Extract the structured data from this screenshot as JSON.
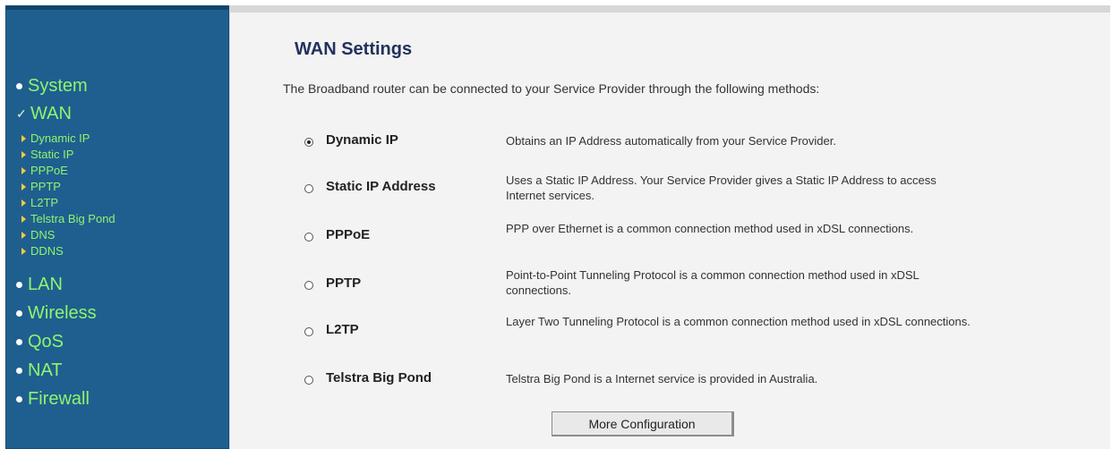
{
  "sidebar": {
    "main_items": [
      {
        "label": "System"
      },
      {
        "label": "WAN"
      },
      {
        "label": "LAN"
      },
      {
        "label": "Wireless"
      },
      {
        "label": "QoS"
      },
      {
        "label": "NAT"
      },
      {
        "label": "Firewall"
      }
    ],
    "wan_subitems": [
      {
        "label": "Dynamic IP"
      },
      {
        "label": "Static IP"
      },
      {
        "label": "PPPoE"
      },
      {
        "label": "PPTP"
      },
      {
        "label": "L2TP"
      },
      {
        "label": "Telstra Big Pond"
      },
      {
        "label": "DNS"
      },
      {
        "label": "DDNS"
      }
    ],
    "selected": "WAN"
  },
  "main": {
    "title": "WAN Settings",
    "intro": "The Broadband router can be connected to your Service Provider through the following methods:",
    "options": [
      {
        "label": "Dynamic IP",
        "checked": true,
        "description": "Obtains an IP Address automatically from your Service Provider."
      },
      {
        "label": "Static IP Address",
        "checked": false,
        "description": "Uses a Static IP Address. Your Service Provider gives a Static IP Address to access Internet services."
      },
      {
        "label": "PPPoE",
        "checked": false,
        "description": "PPP over Ethernet is a common connection method used in xDSL connections."
      },
      {
        "label": "PPTP",
        "checked": false,
        "description": "Point-to-Point Tunneling Protocol is a common connection method used in xDSL connections."
      },
      {
        "label": "L2TP",
        "checked": false,
        "description": "Layer Two Tunneling Protocol is a common connection method used in xDSL connections."
      },
      {
        "label": "Telstra Big Pond",
        "checked": false,
        "description": "Telstra Big Pond is a Internet service is provided in Australia."
      }
    ],
    "more_button": "More Configuration"
  },
  "colors": {
    "sidebar_bg": "#1f5f8f",
    "nav_text": "#8ff56f",
    "title": "#22325c"
  },
  "icons": {
    "main_bullet": "round-bullet-icon",
    "selected_mark": "checkmark-icon",
    "sub_bullet": "triangle-right-icon"
  }
}
